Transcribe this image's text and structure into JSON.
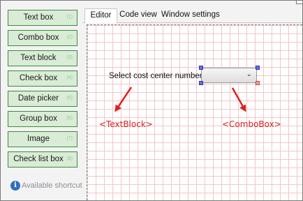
{
  "sidebar": {
    "items": [
      {
        "label": "Text box",
        "shortcut": "(1)"
      },
      {
        "label": "Combo box",
        "shortcut": "(2)"
      },
      {
        "label": "Text block",
        "shortcut": "(3)"
      },
      {
        "label": "Check box",
        "shortcut": "(4)"
      },
      {
        "label": "Date picker",
        "shortcut": "(5)"
      },
      {
        "label": "Group box",
        "shortcut": "(6)"
      },
      {
        "label": "Image",
        "shortcut": "(7)"
      },
      {
        "label": "Check list box",
        "shortcut": "(8)"
      }
    ],
    "shortcut_hint": "Available shortcut",
    "info_icon": "i"
  },
  "tabs": [
    {
      "label": "Editor",
      "active": true
    },
    {
      "label": "Code view",
      "active": false
    },
    {
      "label": "Window settings",
      "active": false
    }
  ],
  "canvas": {
    "label_text": "Select cost center number:",
    "combo_value": "",
    "combo_chevron": "⌄",
    "annotations": {
      "text_block": "<TextBlock>",
      "combo_box": "<ComboBox>"
    }
  },
  "colors": {
    "button_bg": "#d9ecd5",
    "button_border": "#3e8b3e",
    "annotation": "#e02020",
    "grid": "#f2c7c7",
    "info": "#2f6fc1"
  },
  "icons": [
    "info-icon",
    "chevron-down-icon",
    "arrow-icon"
  ]
}
